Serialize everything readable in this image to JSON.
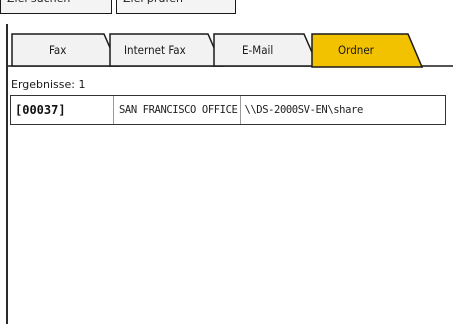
{
  "top_buttons": {
    "left_label": "Ziel suchen",
    "right_label": "Ziel prüfen"
  },
  "tabs": [
    {
      "label": "Fax",
      "active": false
    },
    {
      "label": "Internet Fax",
      "active": false
    },
    {
      "label": "E-Mail",
      "active": false
    },
    {
      "label": "Ordner",
      "active": true
    }
  ],
  "colors": {
    "active_tab": "#f2c200",
    "inactive_tab": "#f2f2f2",
    "outline": "#1a1a1a"
  },
  "results": {
    "label": "Ergebnisse: 1",
    "rows": [
      {
        "id": "[00037]",
        "name": "SAN FRANCISCO OFFICE",
        "path": "\\\\DS-2000SV-EN\\share"
      }
    ]
  }
}
